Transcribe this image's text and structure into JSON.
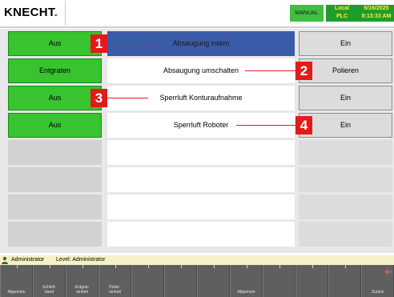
{
  "header": {
    "logo_text": "KNECHT",
    "logo_dot": ".",
    "mode": "MANUAL",
    "status_local": "Local",
    "status_plc": "PLC",
    "date": "6/16/2025",
    "time": "8:13:33 AM"
  },
  "rows": [
    {
      "left": "Aus",
      "middle": "Absaugung intern",
      "right": "Ein",
      "marker": "1"
    },
    {
      "left": "Entgraten",
      "middle": "Absaugung umschalten",
      "right": "Polieren",
      "marker": "2"
    },
    {
      "left": "Aus",
      "middle": "Sperrluft Konturaufnahme",
      "right": "Ein",
      "marker": "3"
    },
    {
      "left": "Aus",
      "middle": "Sperrluft Roboter",
      "right": "Ein",
      "marker": "4"
    }
  ],
  "footer": {
    "user": "Administrator",
    "level": "Level: Administrator",
    "fkeys": [
      "Allgemein",
      "Schleif-\nband",
      "Entgrat-\neinheit",
      "Polier-\neinheit",
      "",
      "",
      "",
      "Allgemein",
      "",
      "",
      "",
      "Zurück"
    ]
  },
  "colors": {
    "active_green": "#37c42f",
    "selected_blue": "#3a5ba8",
    "marker_red": "#e31a1a",
    "status_green": "#1e9d2d",
    "status_text": "#ffeb3b"
  }
}
